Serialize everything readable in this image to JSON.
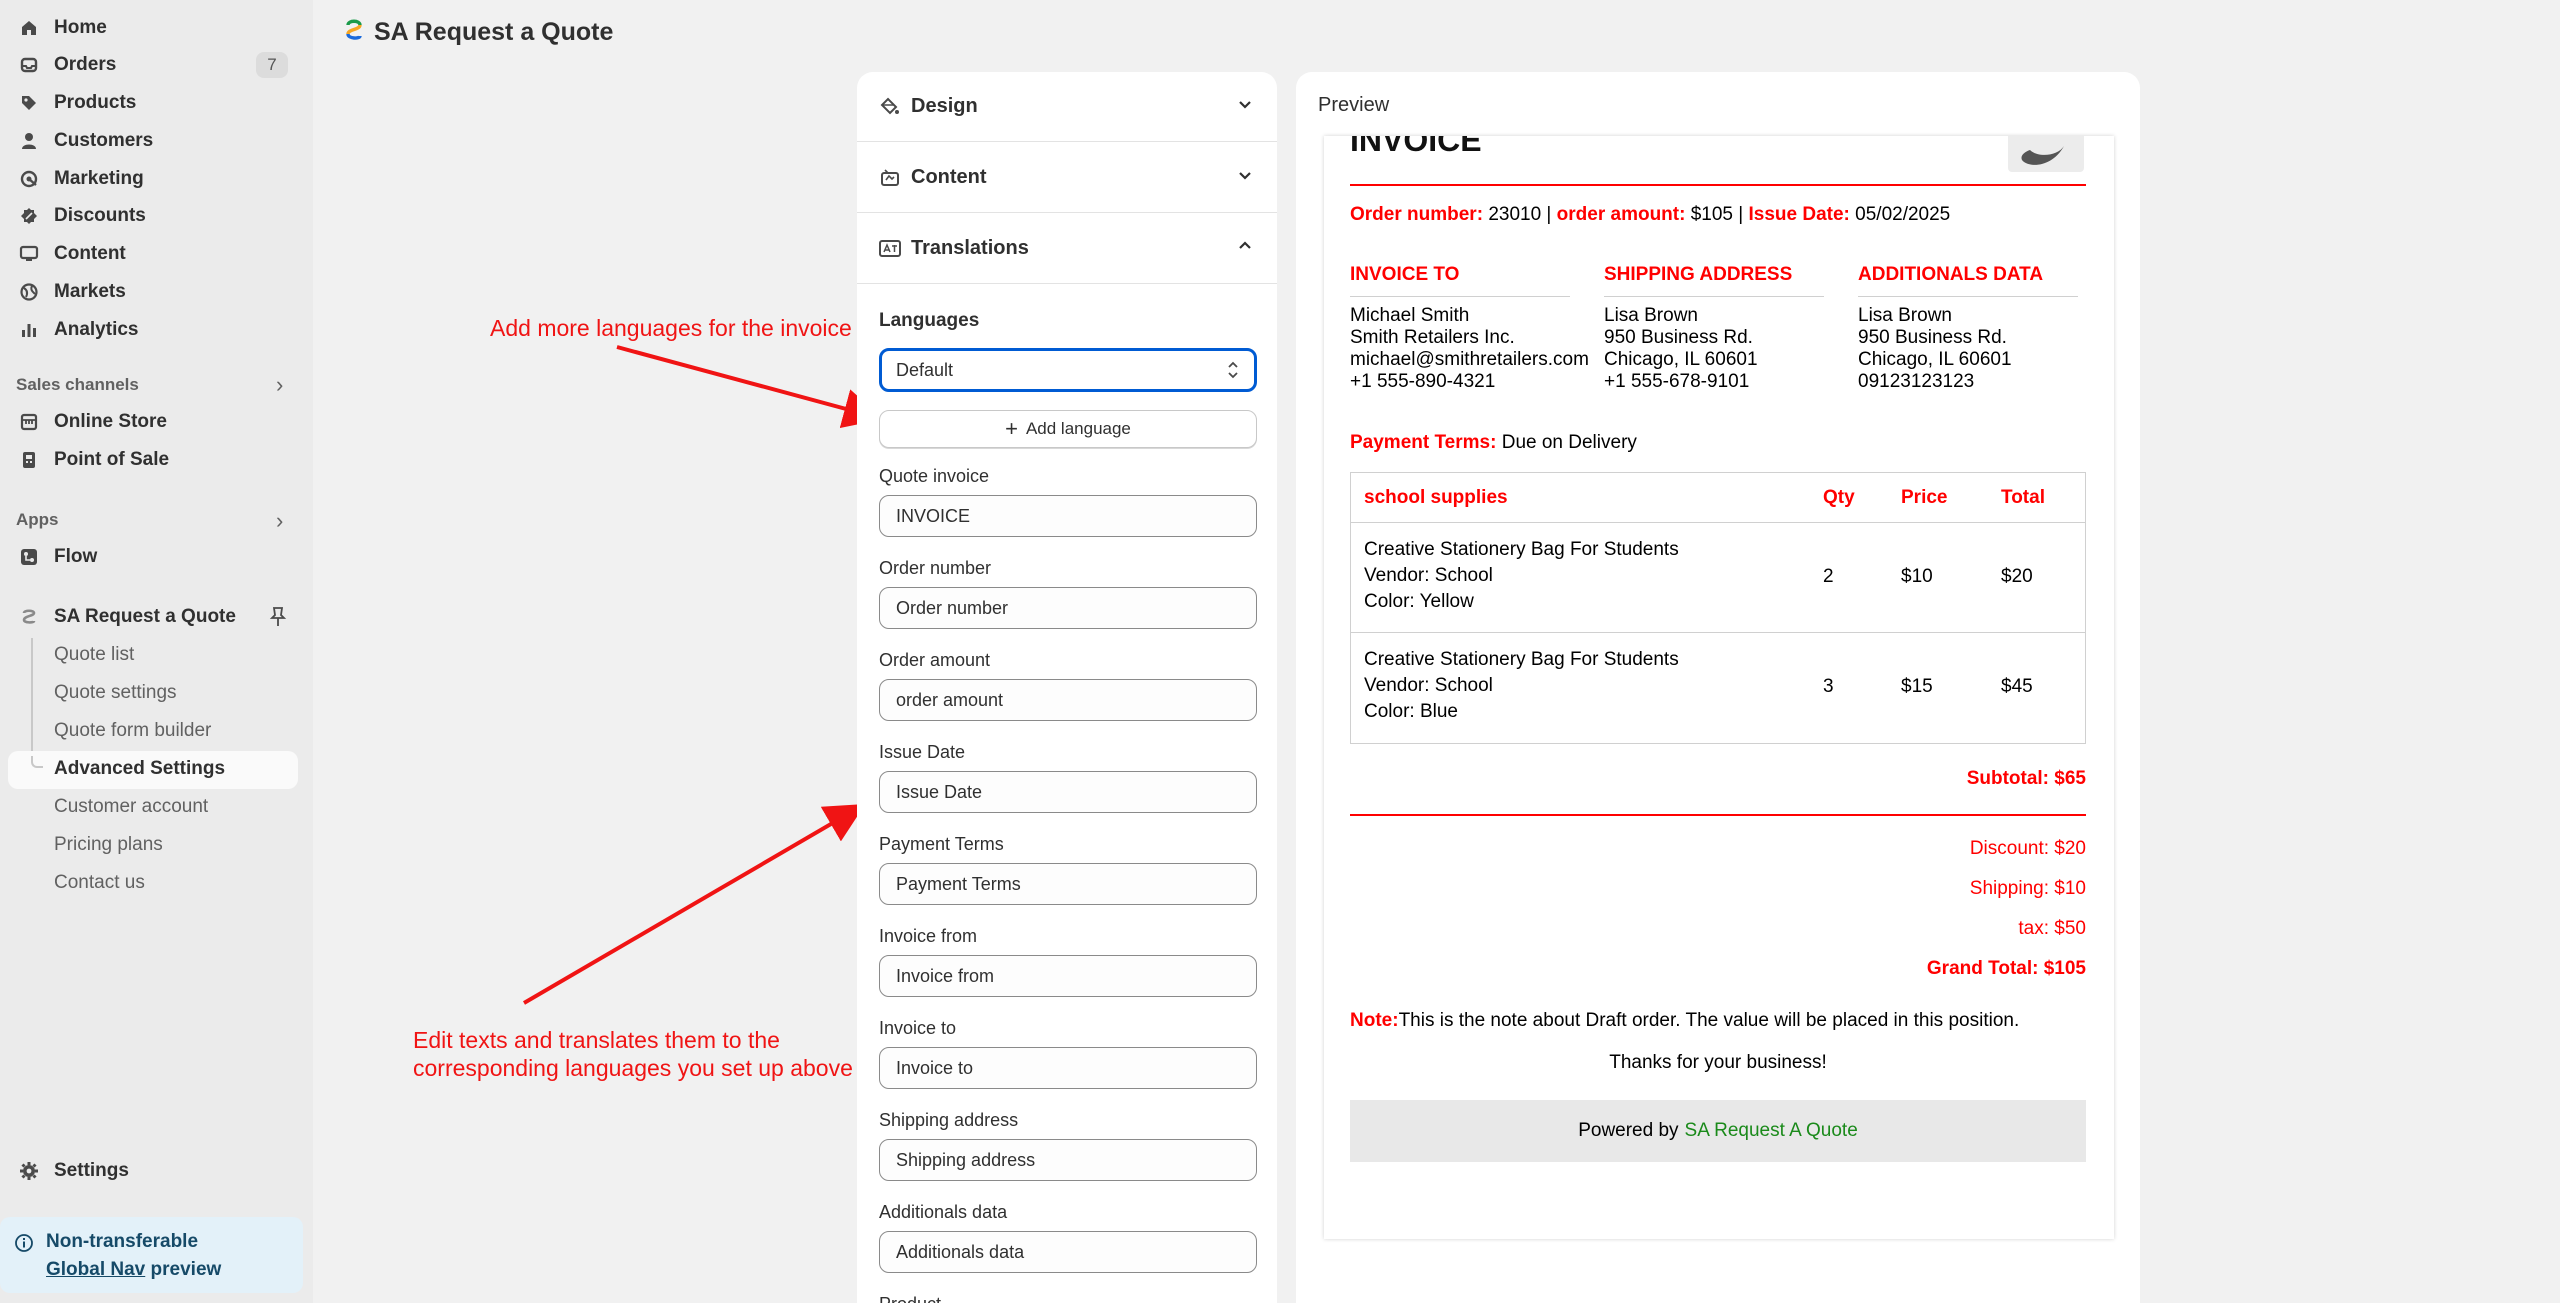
{
  "app_title": "SA Request a Quote",
  "sidebar": {
    "items": [
      {
        "label": "Home",
        "icon": "home-icon"
      },
      {
        "label": "Orders",
        "icon": "orders-icon",
        "badge": "7"
      },
      {
        "label": "Products",
        "icon": "tag-icon"
      },
      {
        "label": "Customers",
        "icon": "person-icon"
      },
      {
        "label": "Marketing",
        "icon": "target-icon"
      },
      {
        "label": "Discounts",
        "icon": "discount-icon"
      },
      {
        "label": "Content",
        "icon": "monitor-icon"
      },
      {
        "label": "Markets",
        "icon": "globe-icon"
      },
      {
        "label": "Analytics",
        "icon": "bar-chart-icon"
      }
    ],
    "sales_channels_label": "Sales channels",
    "sales_channels": [
      {
        "label": "Online Store",
        "icon": "store-icon"
      },
      {
        "label": "Point of Sale",
        "icon": "pos-icon"
      }
    ],
    "apps_label": "Apps",
    "apps": [
      {
        "label": "Flow",
        "icon": "flow-icon"
      }
    ],
    "app_name": "SA Request a Quote",
    "app_sub_items": [
      "Quote list",
      "Quote settings",
      "Quote form builder",
      "Advanced Settings",
      "Customer account",
      "Pricing plans",
      "Contact us"
    ],
    "settings_label": "Settings",
    "notice": {
      "line1": "Non-transferable",
      "link": "Global Nav",
      "line2_rest": " preview"
    }
  },
  "annotations": {
    "top": "Add more languages for the invoice",
    "bottom_line1": "Edit texts and translates them to the",
    "bottom_line2": "corresponding languages you set up above"
  },
  "settings_panel": {
    "sections": [
      "Design",
      "Content",
      "Translations"
    ],
    "languages_label": "Languages",
    "language_selected": "Default",
    "add_language_label": "Add language",
    "fields": [
      {
        "label": "Quote invoice",
        "value": "INVOICE"
      },
      {
        "label": "Order number",
        "value": "Order number"
      },
      {
        "label": "Order amount",
        "value": "order amount"
      },
      {
        "label": "Issue Date",
        "value": "Issue Date"
      },
      {
        "label": "Payment Terms",
        "value": "Payment Terms"
      },
      {
        "label": "Invoice from",
        "value": "Invoice from"
      },
      {
        "label": "Invoice to",
        "value": "Invoice to"
      },
      {
        "label": "Shipping address",
        "value": "Shipping address"
      },
      {
        "label": "Additionals data",
        "value": "Additionals data"
      }
    ],
    "next_field_label": "Product"
  },
  "preview": {
    "title": "Preview",
    "invoice_title": "INVOICE",
    "order_number_label": "Order number:",
    "order_number": "23010",
    "order_amount_label": "order amount:",
    "order_amount": "$105",
    "issue_date_label": "Issue Date:",
    "issue_date": "05/02/2025",
    "invoice_to": {
      "heading": "INVOICE TO",
      "lines": [
        "Michael Smith",
        "Smith Retailers Inc.",
        "michael@smithretailers.com",
        "+1 555-890-4321"
      ]
    },
    "shipping": {
      "heading": "SHIPPING ADDRESS",
      "lines": [
        "Lisa Brown",
        "950 Business Rd.",
        "Chicago, IL 60601",
        "+1 555-678-9101"
      ]
    },
    "additional": {
      "heading": "ADDITIONALS DATA",
      "lines": [
        "Lisa Brown",
        "950 Business Rd.",
        "Chicago, IL 60601",
        "09123123123"
      ]
    },
    "payment_terms_label": "Payment Terms:",
    "payment_terms": "Due on Delivery",
    "table": {
      "headers": [
        "school supplies",
        "Qty",
        "Price",
        "Total"
      ],
      "rows": [
        {
          "name": "Creative Stationery Bag For Students",
          "vendor": "Vendor: School",
          "color": "Color: Yellow",
          "qty": "2",
          "price": "$10",
          "total": "$20"
        },
        {
          "name": "Creative Stationery Bag For Students",
          "vendor": "Vendor: School",
          "color": "Color: Blue",
          "qty": "3",
          "price": "$15",
          "total": "$45"
        }
      ]
    },
    "subtotal": "Subtotal: $65",
    "discount": "Discount: $20",
    "shipping_cost": "Shipping: $10",
    "tax": "tax: $50",
    "grand_total": "Grand Total: $105",
    "note_label": "Note:",
    "note": "This is the note about Draft order. The value will be placed in this position.",
    "thanks": "Thanks for your business!",
    "powered_by": "Powered by",
    "powered_link": "SA Request A Quote"
  },
  "colors": {
    "accent_red": "#ff0000",
    "focus_blue": "#005bd3",
    "link_green": "#1a8a1a"
  }
}
